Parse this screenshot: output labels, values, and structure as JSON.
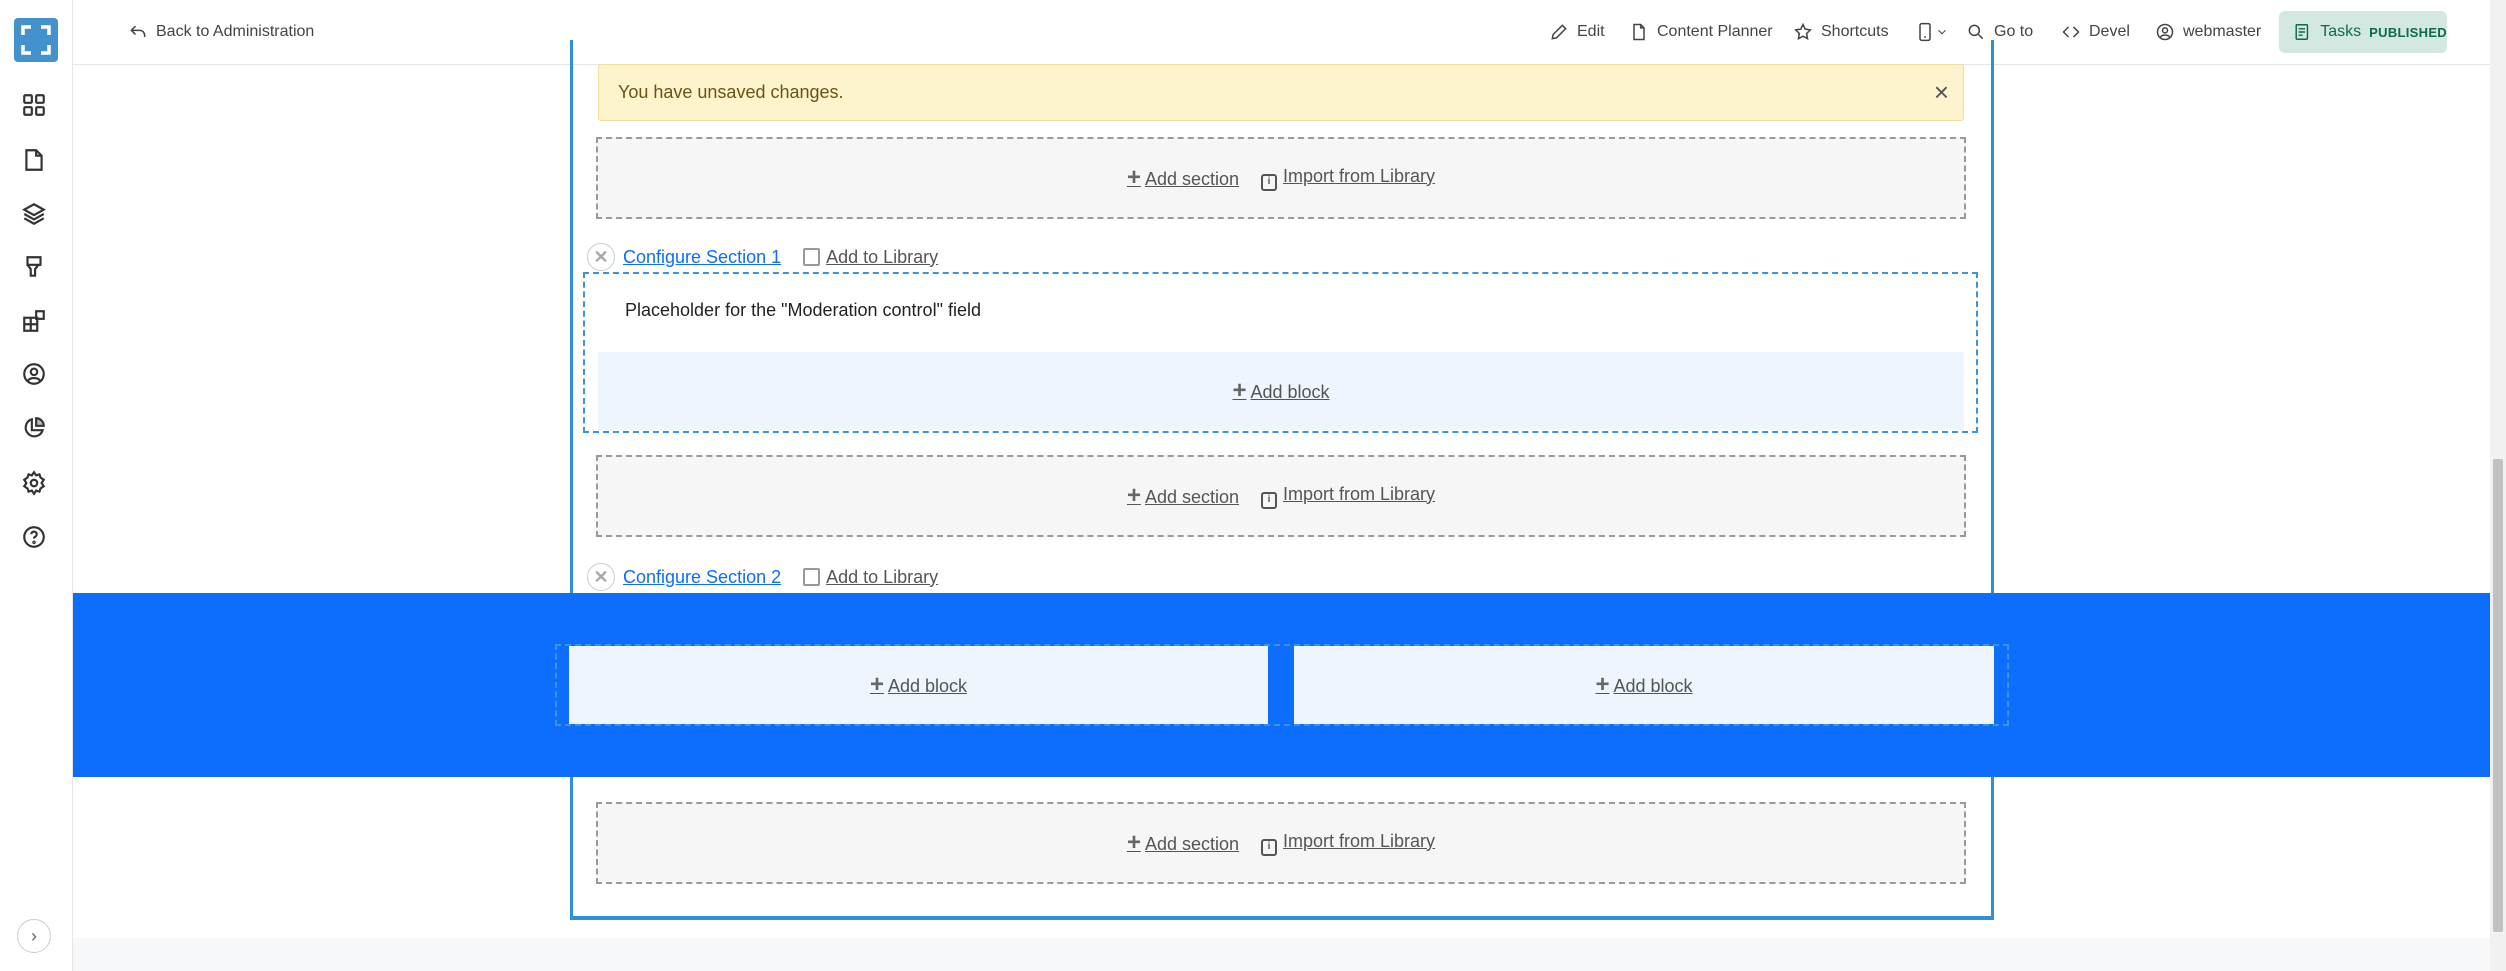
{
  "topbar": {
    "back_label": "Back to Administration",
    "edit_label": "Edit",
    "content_planner_label": "Content Planner",
    "shortcuts_label": "Shortcuts",
    "goto_label": "Go to",
    "devel_label": "Devel",
    "user_label": "webmaster",
    "tasks_label": "Tasks",
    "status_badge": "PUBLISHED"
  },
  "sidebar": {
    "icons": [
      "dashboard-icon",
      "content-icon",
      "structure-icon",
      "appearance-icon",
      "extend-icon",
      "people-icon",
      "reports-icon",
      "configuration-icon",
      "help-icon"
    ]
  },
  "warning": {
    "message": "You have unsaved changes.",
    "close": "×"
  },
  "layout": {
    "add_section_label": "Add section",
    "import_label": "Import from Library",
    "add_block_label": "Add block",
    "add_to_library_label": "Add to Library",
    "plus": "+",
    "remove": "✕",
    "sections": [
      {
        "configure_label": "Configure Section 1",
        "placeholder": "Placeholder for the \"Moderation control\" field"
      },
      {
        "configure_label": "Configure Section 2"
      }
    ]
  },
  "colors": {
    "accent": "#0d6efd",
    "frame": "#2f8fdb",
    "warning_bg": "#fdf3cd",
    "tasks_bg": "#d4e8e2"
  }
}
